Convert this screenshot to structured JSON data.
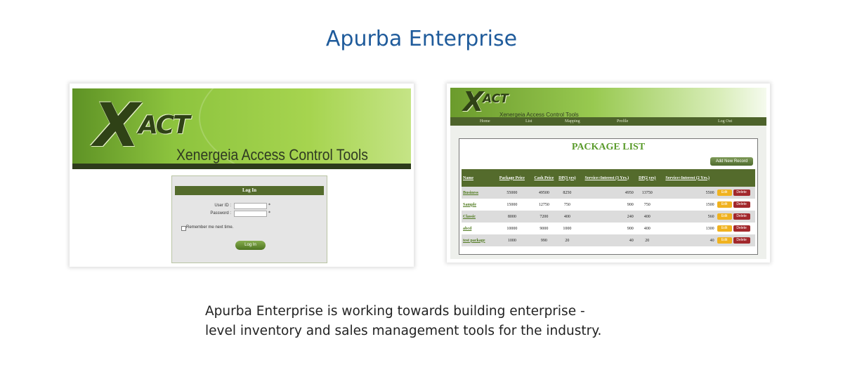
{
  "page": {
    "title": "Apurba Enterprise",
    "caption_line1": "Apurba Enterprise is working towards building enterprise -",
    "caption_line2": "level inventory and sales management tools for the industry."
  },
  "login_screen": {
    "logo_x": "X",
    "logo_act": "ACT",
    "subtitle": "Xenergeia Access Control Tools",
    "box_title": "Log In",
    "user_id_label": "User ID :",
    "password_label": "Password :",
    "required_mark": "*",
    "remember_label": "Remember me next time.",
    "login_button": "Log In"
  },
  "package_screen": {
    "logo_x": "X",
    "logo_act": "ACT",
    "subtitle": "Xenergeia Access Control Tools",
    "nav": [
      "Home",
      "List",
      "Mapping",
      "Profile",
      "Log Out"
    ],
    "panel_title": "PACKAGE LIST",
    "add_button": "Add New Record",
    "columns": [
      "Name",
      "Package Price",
      "Cash Price",
      "DP(3 yrs)",
      "Service+Interest (3 Yrs.)",
      "DP(2 yrs)",
      "Service+Interest (2 Yrs.)",
      ""
    ],
    "edit_label": "Edit",
    "delete_label": "Delete",
    "rows": [
      {
        "name": "Business",
        "package_price": "55000",
        "cash_price": "49500",
        "dp3": "8250",
        "si3": "4950",
        "dp2": "13750",
        "si2": "5500"
      },
      {
        "name": "Sample",
        "package_price": "15000",
        "cash_price": "12750",
        "dp3": "750",
        "si3": "900",
        "dp2": "750",
        "si2": "1500"
      },
      {
        "name": "Classic",
        "package_price": "8000",
        "cash_price": "7200",
        "dp3": "400",
        "si3": "240",
        "dp2": "400",
        "si2": "560"
      },
      {
        "name": "abcd",
        "package_price": "10000",
        "cash_price": "9000",
        "dp3": "1000",
        "si3": "900",
        "dp2": "400",
        "si2": "1300"
      },
      {
        "name": "test package",
        "package_price": "1000",
        "cash_price": "990",
        "dp3": "20",
        "si3": "40",
        "dp2": "20",
        "si2": "40"
      }
    ]
  },
  "colors": {
    "title_blue": "#1f5b9b",
    "brand_green": "#8dc43e",
    "dark_green": "#546b2c",
    "edit_orange": "#f0b21f",
    "delete_red": "#a2282c"
  }
}
